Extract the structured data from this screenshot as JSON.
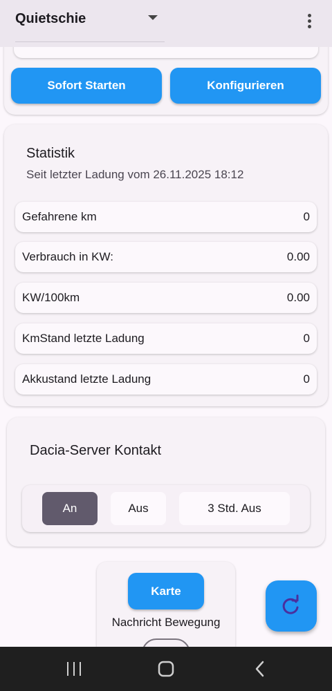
{
  "header": {
    "vehicle": "Quietschie"
  },
  "actions": {
    "start": "Sofort Starten",
    "configure": "Konfigurieren"
  },
  "statistik": {
    "title": "Statistik",
    "subtitle": "Seit letzter Ladung vom 26.11.2025 18:12",
    "rows": [
      {
        "label": "Gefahrene km",
        "value": "0"
      },
      {
        "label": "Verbrauch in KW:",
        "value": "0.00"
      },
      {
        "label": "KW/100km",
        "value": "0.00"
      },
      {
        "label": "KmStand letzte Ladung",
        "value": "0"
      },
      {
        "label": "Akkustand letzte Ladung",
        "value": "0"
      }
    ]
  },
  "server": {
    "title": "Dacia-Server Kontakt",
    "options": [
      "An",
      "Aus",
      "3 Std. Aus"
    ],
    "selected": "An"
  },
  "bottom": {
    "map_button": "Karte",
    "motion_label": "Nachricht Bewegung",
    "motion_enabled": false
  },
  "colors": {
    "accent": "#2196f3",
    "selected_segment": "#615a6c"
  }
}
